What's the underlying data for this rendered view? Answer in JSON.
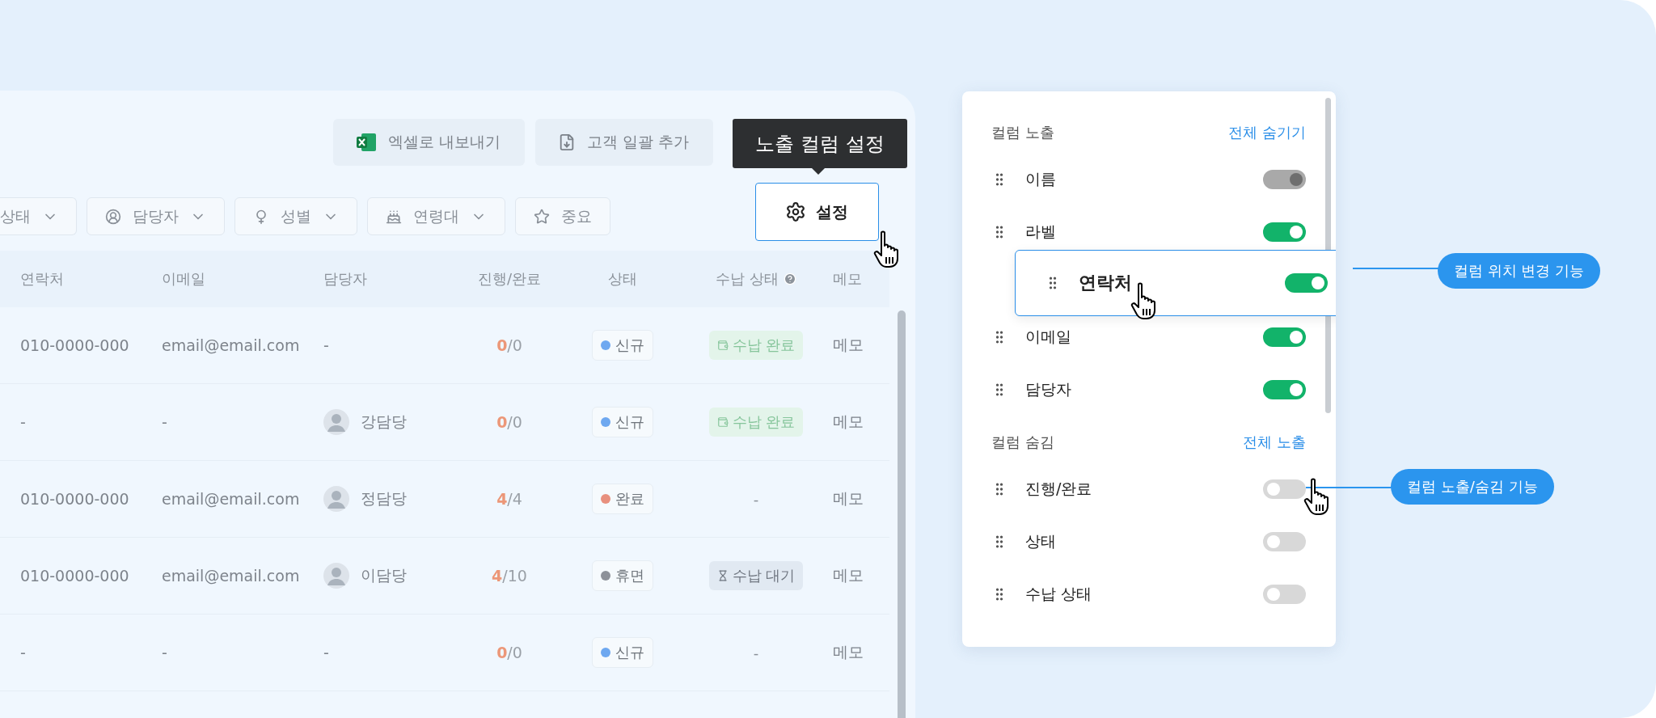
{
  "toolbar": {
    "buttons": [
      {
        "label": "엑셀로 내보내기",
        "kind": "excel"
      },
      {
        "label": "고객 일괄 추가",
        "kind": "import"
      }
    ],
    "tooltip": "노출 컬럼 설정",
    "settings_button": "설정"
  },
  "filters": [
    {
      "label": "상태",
      "kind": "none",
      "dropdown": true
    },
    {
      "label": "담당자",
      "kind": "person",
      "dropdown": true
    },
    {
      "label": "성별",
      "kind": "gender",
      "dropdown": true
    },
    {
      "label": "연령대",
      "kind": "cake",
      "dropdown": true
    },
    {
      "label": "중요",
      "kind": "star",
      "dropdown": false
    }
  ],
  "table": {
    "columns": [
      {
        "label": "연락처",
        "help": false
      },
      {
        "label": "이메일",
        "help": false
      },
      {
        "label": "담당자",
        "help": false
      },
      {
        "label": "진행/완료",
        "help": false
      },
      {
        "label": "상태",
        "help": false
      },
      {
        "label": "수납 상태",
        "help": true
      },
      {
        "label": "메모",
        "help": false
      }
    ],
    "rows": [
      {
        "contact": "010-0000-000",
        "email": "email@email.com",
        "manager": {
          "name": "-",
          "avatar": false
        },
        "progress": "**0**/0",
        "status": {
          "label": "신규",
          "color": "#6ea8f0"
        },
        "payment": {
          "label": "수납 완료",
          "kind": "done"
        },
        "memo": "메모"
      },
      {
        "contact": "-",
        "email": "-",
        "manager": {
          "name": "강담당",
          "avatar": true
        },
        "progress": "**0**/0",
        "status": {
          "label": "신규",
          "color": "#6ea8f0"
        },
        "payment": {
          "label": "수납 완료",
          "kind": "done"
        },
        "memo": "메모"
      },
      {
        "contact": "010-0000-000",
        "email": "email@email.com",
        "manager": {
          "name": "정담당",
          "avatar": true
        },
        "progress": "**4**/4",
        "status": {
          "label": "완료",
          "color": "#e8907e"
        },
        "payment": {
          "label": "-",
          "kind": "none"
        },
        "memo": "메모"
      },
      {
        "contact": "010-0000-000",
        "email": "email@email.com",
        "manager": {
          "name": "이담당",
          "avatar": true
        },
        "progress": "**4**/10",
        "status": {
          "label": "휴면",
          "color": "#8d9199"
        },
        "payment": {
          "label": "수납 대기",
          "kind": "waiting"
        },
        "memo": "메모"
      },
      {
        "contact": "-",
        "email": "-",
        "manager": {
          "name": "-",
          "avatar": false
        },
        "progress": "**0**/0",
        "status": {
          "label": "신규",
          "color": "#6ea8f0"
        },
        "payment": {
          "label": "-",
          "kind": "none"
        },
        "memo": "메모"
      }
    ]
  },
  "panel": {
    "sections": [
      {
        "title": "컬럼 노출",
        "action": "전체 숨기기",
        "items": [
          {
            "label": "이름",
            "kind": "row",
            "on": true,
            "disabled": true
          },
          {
            "label": "라벨",
            "kind": "row",
            "on": true,
            "disabled": false
          },
          {
            "label": "연락처",
            "kind": "dragging",
            "on": true,
            "disabled": false
          },
          {
            "label": "이메일",
            "kind": "row",
            "on": true,
            "disabled": false
          },
          {
            "label": "담당자",
            "kind": "row",
            "on": true,
            "disabled": false
          }
        ]
      },
      {
        "title": "컬럼 숨김",
        "action": "전체 노출",
        "items": [
          {
            "label": "진행/완료",
            "kind": "row",
            "on": false,
            "disabled": false
          },
          {
            "label": "상태",
            "kind": "row",
            "on": false,
            "disabled": false
          },
          {
            "label": "수납 상태",
            "kind": "row",
            "on": false,
            "disabled": false
          }
        ]
      }
    ]
  },
  "callouts": [
    {
      "label": "컬럼 위치 변경 기능"
    },
    {
      "label": "컬럼 노출/숨김 기능"
    }
  ]
}
